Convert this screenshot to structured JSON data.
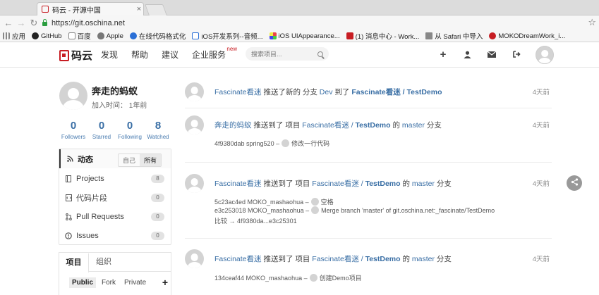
{
  "browser": {
    "tab_title": "码云 - 开源中国",
    "url": "https://git.oschina.net",
    "bookmarks": [
      "应用",
      "GitHub",
      "百度",
      "Apple",
      "在线代码格式化",
      "iOS开发系列--音频...",
      "iOS UIAppearance...",
      "(1) 消息中心 - Work...",
      "从 Safari 中导入",
      "MOKODreamWork_i..."
    ]
  },
  "header": {
    "logo_text": "码云",
    "nav": [
      "发现",
      "帮助",
      "建议",
      "企业服务"
    ],
    "new_badge": "new",
    "search_placeholder": "搜索项目..."
  },
  "profile": {
    "name": "奔走的蚂蚁",
    "joined": "加入时间： 1年前",
    "stats": [
      {
        "num": "0",
        "label": "Followers"
      },
      {
        "num": "0",
        "label": "Starred"
      },
      {
        "num": "0",
        "label": "Following"
      },
      {
        "num": "8",
        "label": "Watched"
      }
    ]
  },
  "sidebar": {
    "items": [
      {
        "label": "动态",
        "icon": "rss-icon"
      },
      {
        "label": "Projects",
        "count": "8",
        "icon": "book-icon"
      },
      {
        "label": "代码片段",
        "count": "0",
        "icon": "code-icon"
      },
      {
        "label": "Pull Requests",
        "count": "0",
        "icon": "pull-request-icon"
      },
      {
        "label": "Issues",
        "count": "0",
        "icon": "issue-icon"
      }
    ],
    "toggle": [
      "自己",
      "所有"
    ]
  },
  "org": {
    "tabs": [
      "项目",
      "组织"
    ],
    "filters": [
      "Public",
      "Fork",
      "Private"
    ],
    "plus": "+"
  },
  "feed": [
    {
      "parts": [
        "Fascinate看迷",
        " 推送了新的 分支 ",
        "Dev",
        " 到了 ",
        "Fascinate看迷 / TestDemo"
      ],
      "time": "4天前"
    },
    {
      "parts": [
        "奔走的蚂蚁",
        " 推送到了 项目 ",
        "Fascinate看迷 / ",
        "TestDemo",
        " 的 ",
        "master",
        " 分支"
      ],
      "time": "4天前",
      "commits": [
        {
          "hash": "4f9380dab spring520 –",
          "msg": "修改一行代码"
        }
      ]
    },
    {
      "parts": [
        "Fascinate看迷",
        " 推送到了 项目 ",
        "Fascinate看迷 / ",
        "TestDemo",
        " 的 ",
        "master",
        " 分支"
      ],
      "time": "4天前",
      "commits": [
        {
          "hash": "5c23ac4ed MOKO_mashaohua –",
          "msg": "空格"
        },
        {
          "hash": "e3c253018 MOKO_mashaohua –",
          "msg": "Merge branch 'master' of git.oschina.net:_fascinate/TestDemo"
        }
      ],
      "compare": "比较 → 4f9380da...e3c25301"
    },
    {
      "parts": [
        "Fascinate看迷",
        " 推送到了 项目 ",
        "Fascinate看迷 / ",
        "TestDemo",
        " 的 ",
        "master",
        " 分支"
      ],
      "time": "4天前",
      "commits": [
        {
          "hash": "134ceaf44 MOKO_mashaohua –",
          "msg": "创建Demo项目"
        }
      ]
    }
  ]
}
